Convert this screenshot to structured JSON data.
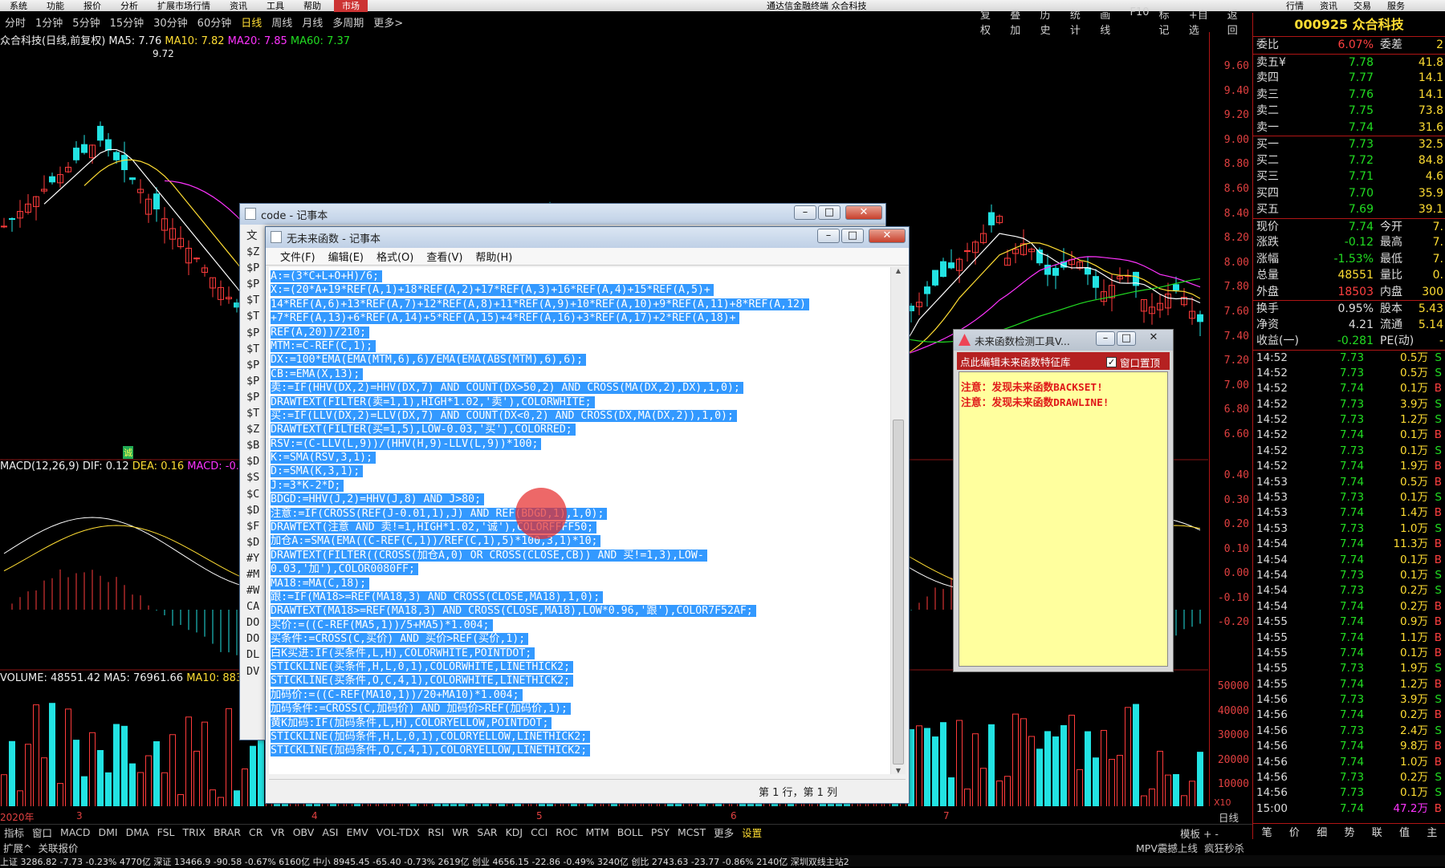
{
  "app": {
    "window_title": "通达信金融终端 众合科技",
    "menu": [
      "系统",
      "功能",
      "报价",
      "分析",
      "扩展市场行情",
      "资讯",
      "工具",
      "帮助"
    ],
    "market_tab": "市场",
    "right_menu": [
      "行情",
      "资讯",
      "交易",
      "服务"
    ]
  },
  "toolbar": {
    "periods": [
      "分时",
      "1分钟",
      "5分钟",
      "15分钟",
      "30分钟",
      "60分钟",
      "日线",
      "周线",
      "月线",
      "多周期",
      "更多>"
    ],
    "active_period": "日线",
    "tools": [
      "复权",
      "叠加",
      "历史",
      "统计",
      "画线",
      "F10",
      "标记",
      "+自选",
      "返回"
    ]
  },
  "chart_info": {
    "title": "众合科技(日线,前复权)",
    "ma5": "MA5: 7.76",
    "ma10": "MA10: 7.82",
    "ma20": "MA20: 7.85",
    "ma60": "MA60: 7.37",
    "high_label": "9.72",
    "macd_line": "MACD(12,26,9)",
    "dif": "DIF: 0.12",
    "dea": "DEA: 0.16",
    "macd": "MACD: -0.0",
    "volume_line": "VOLUME: 48551.42",
    "vol_ma5": "MA5: 76961.66",
    "vol_ma10": "MA10: 8837",
    "cursor_label": "诚",
    "x_labels": [
      "2020年",
      "3",
      "4",
      "5",
      "6",
      "7"
    ],
    "axis_unit": "X10"
  },
  "price_axis": [
    "9.60",
    "9.40",
    "9.20",
    "9.00",
    "8.80",
    "8.60",
    "8.40",
    "8.20",
    "8.00",
    "7.80",
    "7.60",
    "7.40",
    "7.20",
    "7.00",
    "6.80",
    "6.60"
  ],
  "macd_axis": [
    "0.40",
    "0.30",
    "0.20",
    "0.10",
    "0.00",
    "-0.10",
    "-0.20"
  ],
  "vol_axis": [
    "50000",
    "40000",
    "30000",
    "20000",
    "10000"
  ],
  "bottom_tabs": [
    "指标",
    "窗口",
    "MACD",
    "DMI",
    "DMA",
    "FSL",
    "TRIX",
    "BRAR",
    "CR",
    "VR",
    "OBV",
    "ASI",
    "EMV",
    "VOL-TDX",
    "RSI",
    "WR",
    "SAR",
    "KDJ",
    "CCI",
    "ROC",
    "MTM",
    "BOLL",
    "PSY",
    "MCST",
    "更多",
    "设置"
  ],
  "bottom_tabs_active": "设置",
  "bottom_right": "模板 + -",
  "axis_corner": "日线",
  "row2": {
    "left": [
      "扩展^",
      "关联报价"
    ],
    "right": [
      "MPV震撼上线",
      "疯狂秒杀"
    ]
  },
  "status_bar": "上证 3286.82  -7.73  -0.23% 4770亿    深证 13466.9  -90.58  -0.67% 6160亿    中小 8945.45  -65.40  -0.73% 2619亿    创业 4656.15  -22.86  -0.49% 3240亿    创比 2743.63  -23.77  -0.86% 2140亿              深圳双线主站2",
  "quote": {
    "code_name": "000925 众合科技",
    "rows": [
      {
        "l": "委比",
        "lv": "6.07%",
        "r": "委差",
        "rv": "2"
      },
      {
        "l": "卖五¥",
        "lv": "7.78",
        "rv": "41.8"
      },
      {
        "l": "卖四",
        "lv": "7.77",
        "rv": "14.1"
      },
      {
        "l": "卖三",
        "lv": "7.76",
        "rv": "14.1"
      },
      {
        "l": "卖二",
        "lv": "7.75",
        "rv": "73.8"
      },
      {
        "l": "卖一",
        "lv": "7.74",
        "rv": "31.6"
      },
      {
        "l": "买一",
        "lv": "7.73",
        "rv": "32.5"
      },
      {
        "l": "买二",
        "lv": "7.72",
        "rv": "84.8"
      },
      {
        "l": "买三",
        "lv": "7.71",
        "rv": "4.6"
      },
      {
        "l": "买四",
        "lv": "7.70",
        "rv": "35.9"
      },
      {
        "l": "买五",
        "lv": "7.69",
        "rv": "39.1"
      },
      {
        "l": "现价",
        "lv": "7.74",
        "r": "今开",
        "rv": "7."
      },
      {
        "l": "涨跌",
        "lv": "-0.12",
        "r": "最高",
        "rv": "7."
      },
      {
        "l": "涨幅",
        "lv": "-1.53%",
        "r": "最低",
        "rv": "7."
      },
      {
        "l": "总量",
        "lv": "48551",
        "r": "量比",
        "rv": "0."
      },
      {
        "l": "外盘",
        "lv": "18503",
        "r": "内盘",
        "rv": "300"
      },
      {
        "l": "换手",
        "lv": "0.95%",
        "r": "股本",
        "rv": "5.43"
      },
      {
        "l": "净资",
        "lv": "4.21",
        "r": "流通",
        "rv": "5.14"
      },
      {
        "l": "收益(一)",
        "lv": "-0.281",
        "r": "PE(动)",
        "rv": "-"
      }
    ],
    "ticks": [
      {
        "t": "14:52",
        "p": "7.73",
        "v": "0.5万",
        "d": "S"
      },
      {
        "t": "14:52",
        "p": "7.73",
        "v": "0.5万",
        "d": "S"
      },
      {
        "t": "14:52",
        "p": "7.74",
        "v": "0.1万",
        "d": "B"
      },
      {
        "t": "14:52",
        "p": "7.73",
        "v": "3.9万",
        "d": "S"
      },
      {
        "t": "14:52",
        "p": "7.73",
        "v": "1.2万",
        "d": "S"
      },
      {
        "t": "14:52",
        "p": "7.74",
        "v": "0.1万",
        "d": "B"
      },
      {
        "t": "14:52",
        "p": "7.73",
        "v": "0.1万",
        "d": "S"
      },
      {
        "t": "14:52",
        "p": "7.74",
        "v": "1.9万",
        "d": "B"
      },
      {
        "t": "14:53",
        "p": "7.74",
        "v": "0.5万",
        "d": "B"
      },
      {
        "t": "14:53",
        "p": "7.73",
        "v": "0.1万",
        "d": "S"
      },
      {
        "t": "14:53",
        "p": "7.74",
        "v": "1.4万",
        "d": "B"
      },
      {
        "t": "14:53",
        "p": "7.73",
        "v": "1.0万",
        "d": "S"
      },
      {
        "t": "14:54",
        "p": "7.74",
        "v": "11.3万",
        "d": "B"
      },
      {
        "t": "14:54",
        "p": "7.74",
        "v": "0.1万",
        "d": "B"
      },
      {
        "t": "14:54",
        "p": "7.73",
        "v": "0.1万",
        "d": "S"
      },
      {
        "t": "14:54",
        "p": "7.73",
        "v": "0.2万",
        "d": "S"
      },
      {
        "t": "14:54",
        "p": "7.74",
        "v": "0.2万",
        "d": "B"
      },
      {
        "t": "14:55",
        "p": "7.74",
        "v": "0.9万",
        "d": "B"
      },
      {
        "t": "14:55",
        "p": "7.74",
        "v": "1.1万",
        "d": "B"
      },
      {
        "t": "14:55",
        "p": "7.74",
        "v": "0.1万",
        "d": "B"
      },
      {
        "t": "14:55",
        "p": "7.73",
        "v": "1.9万",
        "d": "S"
      },
      {
        "t": "14:55",
        "p": "7.74",
        "v": "1.2万",
        "d": "B"
      },
      {
        "t": "14:56",
        "p": "7.73",
        "v": "3.9万",
        "d": "S"
      },
      {
        "t": "14:56",
        "p": "7.74",
        "v": "0.2万",
        "d": "B"
      },
      {
        "t": "14:56",
        "p": "7.73",
        "v": "2.4万",
        "d": "S"
      },
      {
        "t": "14:56",
        "p": "7.74",
        "v": "9.8万",
        "d": "B"
      },
      {
        "t": "14:56",
        "p": "7.74",
        "v": "1.0万",
        "d": "B"
      },
      {
        "t": "14:56",
        "p": "7.73",
        "v": "0.2万",
        "d": "S"
      },
      {
        "t": "14:56",
        "p": "7.73",
        "v": "0.1万",
        "d": "S"
      },
      {
        "t": "15:00",
        "p": "7.74",
        "v": "47.2万",
        "d": "B"
      }
    ],
    "bottom_tabs": [
      "笔",
      "价",
      "细",
      "势",
      "联",
      "值",
      "主"
    ]
  },
  "notepad_back": {
    "title": "code - 记事本",
    "side_chars": [
      "文",
      "$Z",
      "$P",
      "$P",
      "$T",
      "$T",
      "$P",
      "$T",
      "$P",
      "$P",
      "$P",
      "$T",
      "$Z",
      "$B",
      "$D",
      "$S",
      "$C",
      "$D",
      "$F",
      "$D",
      "#Y",
      "#M",
      "#W",
      "CA",
      "DO",
      "DO",
      "DL",
      "DV"
    ]
  },
  "notepad_front": {
    "title": "无未来函数 - 记事本",
    "menu": [
      "文件(F)",
      "编辑(E)",
      "格式(O)",
      "查看(V)",
      "帮助(H)"
    ],
    "status": "第 1 行，第 1 列",
    "lines": [
      "A:=(3*C+L+O+H)/6;",
      "X:=(20*A+19*REF(A,1)+18*REF(A,2)+17*REF(A,3)+16*REF(A,4)+15*REF(A,5)+",
      "14*REF(A,6)+13*REF(A,7)+12*REF(A,8)+11*REF(A,9)+10*REF(A,10)+9*REF(A,11)+8*REF(A,12)",
      "+7*REF(A,13)+6*REF(A,14)+5*REF(A,15)+4*REF(A,16)+3*REF(A,17)+2*REF(A,18)+",
      "REF(A,20))/210;",
      "MTM:=C-REF(C,1);",
      "DX:=100*EMA(EMA(MTM,6),6)/EMA(EMA(ABS(MTM),6),6);",
      "CB:=EMA(X,13);",
      "卖:=IF(HHV(DX,2)=HHV(DX,7) AND COUNT(DX>50,2) AND CROSS(MA(DX,2),DX),1,0);",
      "DRAWTEXT(FILTER(卖=1,1),HIGH*1.02,'卖'),COLORWHITE;",
      "买:=IF(LLV(DX,2)=LLV(DX,7) AND COUNT(DX<0,2) AND CROSS(DX,MA(DX,2)),1,0);",
      "DRAWTEXT(FILTER(买=1,5),LOW-0.03,'买'),COLORRED;",
      "RSV:=(C-LLV(L,9))/(HHV(H,9)-LLV(L,9))*100;",
      "K:=SMA(RSV,3,1);",
      "D:=SMA(K,3,1);",
      "J:=3*K-2*D;",
      "BDGD:=HHV(J,2)=HHV(J,8) AND J>80;",
      "注意:=IF(CROSS(REF(J-0.01,1),J) AND REF(BDGD,1),1,0);",
      "DRAWTEXT(注意 AND 卖!=1,HIGH*1.02,'诚'),COLORFFFF50;",
      "加仓A:=SMA(EMA((C-REF(C,1))/REF(C,1),5)*100,3,1)*10;",
      "DRAWTEXT(FILTER((CROSS(加仓A,0) OR CROSS(CLOSE,CB)) AND 买!=1,3),LOW-",
      "0.03,'加'),COLOR0080FF;",
      "MA18:=MA(C,18);",
      "跟:=IF(MA18>=REF(MA18,3) AND CROSS(CLOSE,MA18),1,0);",
      "DRAWTEXT(MA18>=REF(MA18,3) AND CROSS(CLOSE,MA18),LOW*0.96,'跟'),COLOR7F52AF;",
      "买价:=((C-REF(MA5,1))/5+MA5)*1.004;",
      "买条件:=CROSS(C,买价) AND 买价>REF(买价,1);",
      "白K买进:IF(买条件,L,H),COLORWHITE,POINTDOT;",
      "STICKLINE(买条件,H,L,0,1),COLORWHITE,LINETHICK2;",
      "STICKLINE(买条件,O,C,4,1),COLORWHITE,LINETHICK2;",
      "加码价:=((C-REF(MA10,1))/20+MA10)*1.004;",
      "加码条件:=CROSS(C,加码价) AND 加码价>REF(加码价,1);",
      "黄K加码:IF(加码条件,L,H),COLORYELLOW,POINTDOT;",
      "STICKLINE(加码条件,H,L,0,1),COLORYELLOW,LINETHICK2;",
      "STICKLINE(加码条件,O,C,4,1),COLORYELLOW,LINETHICK2;"
    ]
  },
  "detector": {
    "title": "未来函数检测工具V...",
    "header": "点此编辑未来函数特征库",
    "checkbox_label": "窗口置顶",
    "checkbox_checked": true,
    "messages": [
      "注意：发现未来函数BACKSET!",
      "注意：发现未来函数DRAWLINE!"
    ]
  },
  "colors": {
    "up": "#ff3b3b",
    "down": "#22e3e3",
    "ma5": "#ffffff",
    "ma10": "#ffdd33",
    "ma20": "#ff33ff",
    "ma60": "#22dd22",
    "selection": "#3399ff"
  }
}
